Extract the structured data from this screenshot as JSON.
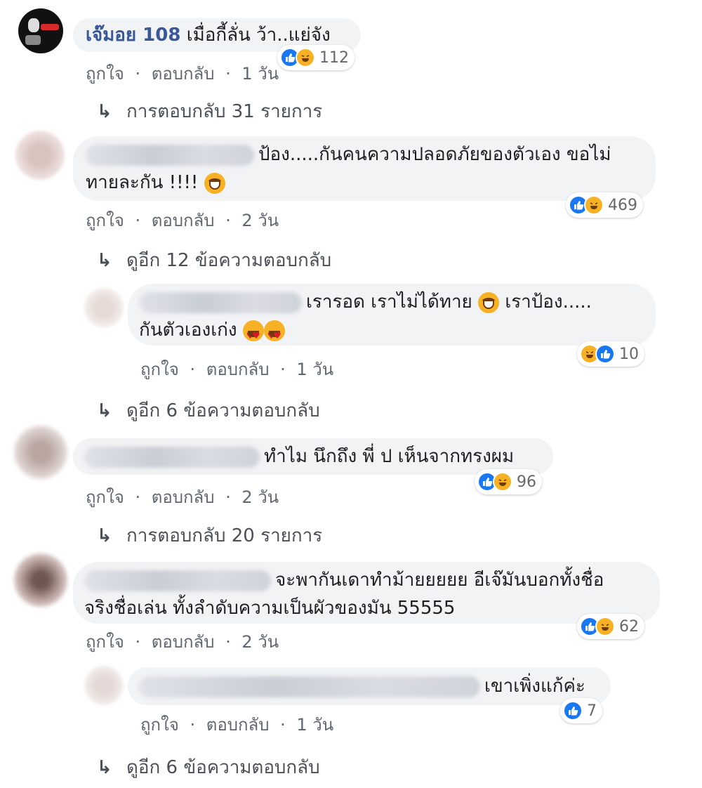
{
  "actions": {
    "like": "ถูกใจ",
    "sep": "·",
    "reply": "ตอบกลับ"
  },
  "comments": [
    {
      "author": "เจ๊มอย 108",
      "text": "เมื่อกี้ลั่น ว้า..แย่จัง",
      "time": "1 วัน",
      "reactions": {
        "count": "112",
        "types": [
          "like-icon",
          "haha-icon"
        ]
      },
      "replies_link": "การตอบกลับ 31 รายการ"
    },
    {
      "text_line1": "ป้อง.....กันคนความปลอดภัยของตัวเอง ขอไม่",
      "text_line2": "ทายละกัน !!!!",
      "time": "2 วัน",
      "reactions": {
        "count": "469",
        "types": [
          "like-icon",
          "haha-icon"
        ]
      },
      "replies_link": "ดูอีก 12 ข้อความตอบกลับ",
      "reply": {
        "text_line1a": "เรารอด เราไม่ได้ทาย",
        "text_line1b": "เราป้อง.....",
        "text_line2": "กันตัวเองเก่ง",
        "time": "1 วัน",
        "reactions": {
          "count": "10",
          "types": [
            "haha-icon",
            "like-icon"
          ]
        }
      },
      "more_link": "ดูอีก 6 ข้อความตอบกลับ"
    },
    {
      "text": "ทำไม นึกถึง พี่ ป เห็นจากทรงผม",
      "time": "2 วัน",
      "reactions": {
        "count": "96",
        "types": [
          "like-icon",
          "haha-icon"
        ]
      },
      "replies_link": "การตอบกลับ 20 รายการ"
    },
    {
      "text_line1": "จะพากันเดาทำม้ายยยยย อีเจ๊มันบอกทั้งชื่อ",
      "text_line2": "จริงชื่อเล่น ทั้งลำดับความเป็นผัวของมัน 55555",
      "time": "2 วัน",
      "reactions": {
        "count": "62",
        "types": [
          "like-icon",
          "haha-icon"
        ]
      },
      "reply": {
        "text": "เขาเพิ่งแก้ค่ะ",
        "time": "1 วัน",
        "reactions": {
          "count": "7",
          "types": [
            "like-icon"
          ]
        }
      },
      "more_link": "ดูอีก 6 ข้อความตอบกลับ"
    }
  ],
  "colors": {
    "bubble": "#f2f3f5",
    "name": "#385898",
    "like": "#1877f2",
    "haha": "#f7b125"
  }
}
